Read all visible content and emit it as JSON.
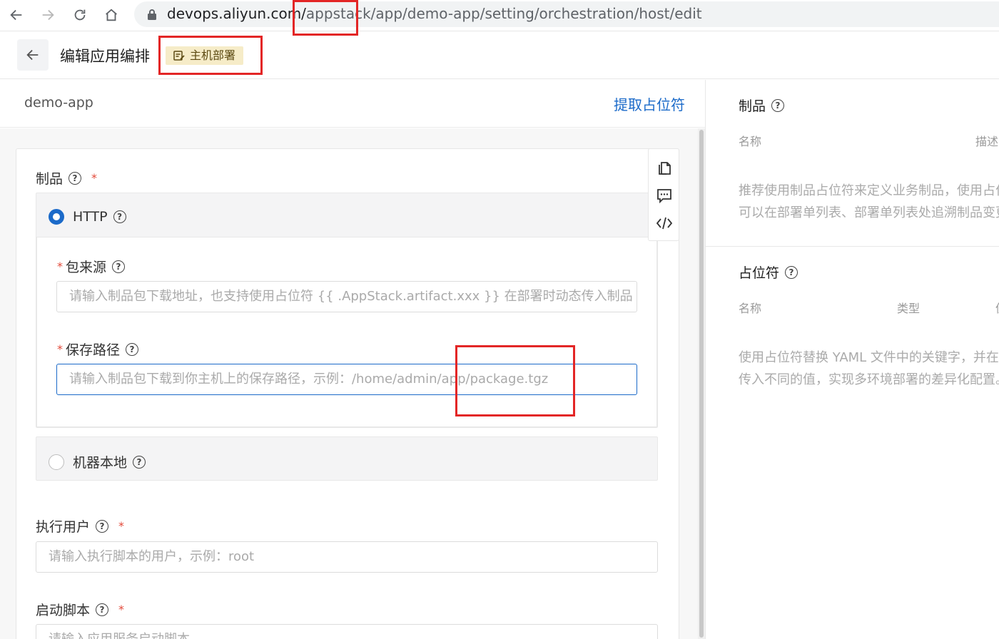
{
  "browser": {
    "url_host": "devops.aliyun.com/",
    "url_path": "appstack/app/demo-app/setting/orchestration/host/edit"
  },
  "header": {
    "title": "编辑应用编排",
    "tag": "主机部署"
  },
  "left": {
    "app_name": "demo-app",
    "extract_link": "提取占位符"
  },
  "form": {
    "artifact_label": "制品",
    "http_option": {
      "label": "HTTP",
      "selected": true,
      "source_label": "包来源",
      "source_placeholder": "请输入制品包下载地址，也支持使用占位符 {{ .AppStack.artifact.xxx }} 在部署时动态传入制品",
      "path_label": "保存路径",
      "path_placeholder": "请输入制品包下载到你主机上的保存路径，示例：/home/admin/app/package.tgz"
    },
    "local_option": {
      "label": "机器本地",
      "selected": false
    },
    "user_label": "执行用户",
    "user_placeholder": "请输入执行脚本的用户，示例：root",
    "script_label": "启动脚本",
    "script_placeholder": "请输入应用服务启动脚本"
  },
  "toolbar": {
    "icons": [
      "copy-icon",
      "comment-icon",
      "code-icon"
    ]
  },
  "right": {
    "artifact_title": "制品",
    "artifact_cols": [
      "名称",
      "描述"
    ],
    "artifact_desc": "推荐使用制品占位符来定义业务制品，使用占位符后可以在部署单列表、部署单列表处追溯制品变更历史",
    "placeholder_title": "占位符",
    "placeholder_cols": [
      "名称",
      "类型",
      "值"
    ],
    "placeholder_desc": "使用占位符替换 YAML 文件中的关键字，并在部署时传入不同的值，实现多环境部署的差异化配置。"
  },
  "colors": {
    "accent": "#1b6ac9",
    "annotation": "#e32626",
    "tag_bg": "#f6ecc8"
  }
}
